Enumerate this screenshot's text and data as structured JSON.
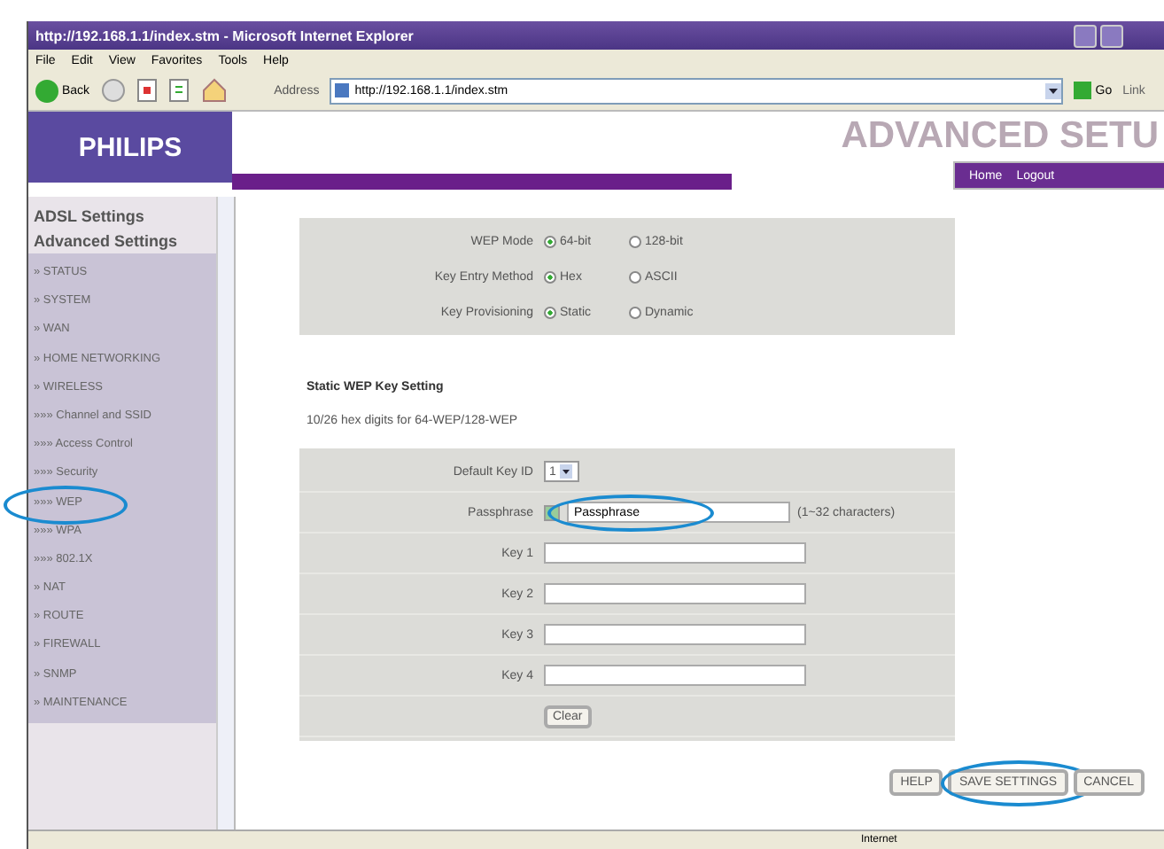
{
  "window": {
    "title": "http://192.168.1.1/index.stm - Microsoft Internet Explorer"
  },
  "menu": [
    "File",
    "Edit",
    "View",
    "Favorites",
    "Tools",
    "Help"
  ],
  "toolbar": {
    "back": "Back",
    "address_label": "Address",
    "address": "http://192.168.1.1/index.stm",
    "go": "Go",
    "links": "Link"
  },
  "header": {
    "logo": "PHILIPS",
    "title": "ADVANCED SETU",
    "nav": [
      "Home",
      "Logout"
    ]
  },
  "sidebar": {
    "headings": [
      "ADSL Settings",
      "Advanced Settings"
    ],
    "items": [
      {
        "label": "» STATUS",
        "annotated": false
      },
      {
        "label": "» SYSTEM",
        "annotated": false
      },
      {
        "label": "» WAN",
        "annotated": false
      },
      {
        "label": "» HOME NETWORKING",
        "annotated": false
      },
      {
        "label": "» WIRELESS",
        "annotated": false
      },
      {
        "label": "»»» Channel and SSID",
        "annotated": false
      },
      {
        "label": "»»» Access Control",
        "annotated": false
      },
      {
        "label": "»»» Security",
        "annotated": false
      },
      {
        "label": "»»» WEP",
        "annotated": true
      },
      {
        "label": "»»» WPA",
        "annotated": false
      },
      {
        "label": "»»» 802.1X",
        "annotated": false
      },
      {
        "label": "» NAT",
        "annotated": false
      },
      {
        "label": "» ROUTE",
        "annotated": false
      },
      {
        "label": "» FIREWALL",
        "annotated": false
      },
      {
        "label": "» SNMP",
        "annotated": false
      },
      {
        "label": "» MAINTENANCE",
        "annotated": false
      }
    ]
  },
  "modes": [
    {
      "label": "WEP Mode",
      "options": [
        {
          "label": "64-bit",
          "selected": true
        },
        {
          "label": "128-bit",
          "selected": false
        }
      ]
    },
    {
      "label": "Key Entry Method",
      "options": [
        {
          "label": "Hex",
          "selected": true
        },
        {
          "label": "ASCII",
          "selected": false
        }
      ]
    },
    {
      "label": "Key Provisioning",
      "options": [
        {
          "label": "Static",
          "selected": true
        },
        {
          "label": "Dynamic",
          "selected": false
        }
      ]
    }
  ],
  "section_title": "Static WEP Key Setting",
  "hint": "10/26 hex digits for 64-WEP/128-WEP",
  "keys": {
    "default_label": "Default Key ID",
    "default_value": "1",
    "passphrase_label": "Passphrase",
    "passphrase_checked": true,
    "passphrase_value": "Passphrase",
    "passphrase_note": "(1~32 characters)",
    "passphrase_annotated": true,
    "fields": [
      {
        "label": "Key 1"
      },
      {
        "label": "Key 2"
      },
      {
        "label": "Key 3"
      },
      {
        "label": "Key 4"
      }
    ],
    "clear": "Clear"
  },
  "buttons": [
    {
      "label": "HELP",
      "annotated": false
    },
    {
      "label": "SAVE SETTINGS",
      "annotated": true
    },
    {
      "label": "CANCEL",
      "annotated": false
    }
  ],
  "status_bar": {
    "zone": "Internet"
  }
}
